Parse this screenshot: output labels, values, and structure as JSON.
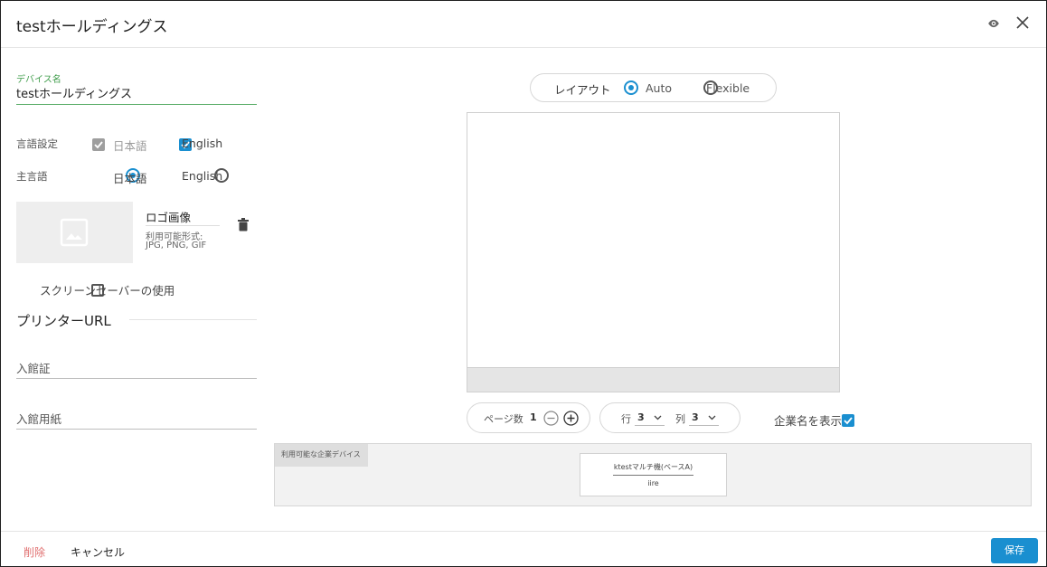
{
  "window": {
    "title": "testホールディングス"
  },
  "form": {
    "device_name_label": "デバイス名",
    "device_name_value": "testホールディングス",
    "language_settings_label": "言語設定",
    "language_options": [
      "日本語",
      "English"
    ],
    "main_language_label": "主言語",
    "main_language_options": [
      "日本語",
      "English"
    ],
    "logo_title": "ロゴ画像",
    "logo_formats_line1": "利用可能形式:",
    "logo_formats_line2": "JPG, PNG, GIF",
    "screensaver_label": "スクリーンセーバーの使用",
    "printer_url_heading": "プリンターURL",
    "entry_pass_placeholder": "入館証",
    "entry_paper_placeholder": "入館用紙"
  },
  "layout": {
    "label": "レイアウト",
    "options": [
      "Auto",
      "Flexible"
    ],
    "selected": "Auto"
  },
  "pagination": {
    "pages_label": "ページ数",
    "pages_value": "1",
    "rows_label": "行",
    "rows_value": "3",
    "cols_label": "列",
    "cols_value": "3",
    "show_company_label": "企業名を表示"
  },
  "available": {
    "tab_label": "利用可能な企業デバイス",
    "device_title": "ktestマルチ機(ベースA)",
    "device_sub": "iire"
  },
  "footer": {
    "delete_label": "削除",
    "cancel_label": "キャンセル",
    "save_label": "保存"
  },
  "colors": {
    "accent": "#1a8fd0",
    "label_green": "#3e9c4a",
    "danger": "#e07070"
  }
}
